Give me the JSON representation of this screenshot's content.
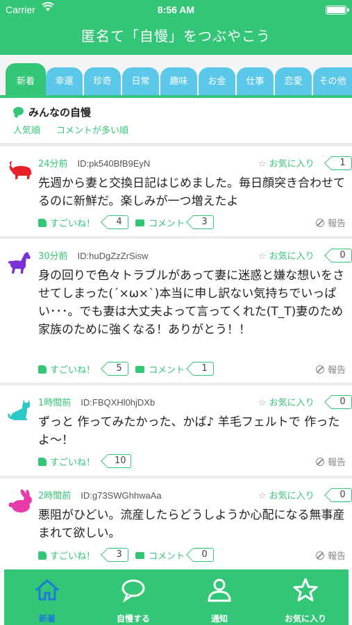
{
  "status_bar": {
    "carrier": "Carrier",
    "time": "8:56 AM"
  },
  "nav": {
    "title": "匿名て「自慢」をつぶやこう"
  },
  "category_tabs": [
    {
      "label": "新着",
      "active": true
    },
    {
      "label": "幸運",
      "active": false
    },
    {
      "label": "珍奇",
      "active": false
    },
    {
      "label": "日常",
      "active": false
    },
    {
      "label": "趣味",
      "active": false
    },
    {
      "label": "お金",
      "active": false
    },
    {
      "label": "仕事",
      "active": false
    },
    {
      "label": "恋愛",
      "active": false
    },
    {
      "label": "その他",
      "active": false
    }
  ],
  "section": {
    "title": "みんなの自慢",
    "sort_popular": "人気順",
    "sort_comments": "コメントが多い順"
  },
  "labels": {
    "favorite": "お気に入り",
    "like": "すごいね！",
    "comment": "コメント",
    "report": "報告"
  },
  "posts": [
    {
      "avatar": "bull-icon",
      "avatar_color": "#e8202a",
      "ago": "24分前",
      "user_id": "ID:pk540BfB9EyN",
      "fav_count": "1",
      "text": "先週から妻と交換日記はじめました。毎日顔突き合わせてるのに新鮮だ。楽しみが一つ増えたよ",
      "like_count": "4",
      "comment_count": "3"
    },
    {
      "avatar": "horse-icon",
      "avatar_color": "#7b2fd6",
      "ago": "30分前",
      "user_id": "ID:huDgZzZrSisw",
      "fav_count": "0",
      "text": "身の回りで色々トラブルがあって妻に迷惑と嫌な想いをさせてしまった(´×ω×`)本当に申し訳ない気持ちでいっぱい･･･。でも妻は大丈夫よって言ってくれた(T_T)妻のため家族のために強くなる！ありがとう！！",
      "like_count": "5",
      "comment_count": "1"
    },
    {
      "avatar": "cat-icon",
      "avatar_color": "#2cc7c7",
      "ago": "1時間前",
      "user_id": "ID:FBQXHl0hjDXb",
      "fav_count": "0",
      "text": "ずっと 作ってみたかった、かば♪ 羊毛フェルトで 作ったよ〜！",
      "like_count": "10",
      "comment_count": ""
    },
    {
      "avatar": "rabbit-icon",
      "avatar_color": "#e83aa9",
      "ago": "2時間前",
      "user_id": "ID:g73SWGhhwaAa",
      "fav_count": "0",
      "text": "悪阻がひどい。流産したらどうしようか心配になる無事産まれて欲しい。",
      "like_count": "3",
      "comment_count": "0"
    }
  ],
  "tabbar": [
    {
      "label": "新着",
      "icon": "home-icon",
      "active": true
    },
    {
      "label": "自慢する",
      "icon": "speech-bubble-icon",
      "active": false
    },
    {
      "label": "通知",
      "icon": "person-icon",
      "active": false
    },
    {
      "label": "お気に入り",
      "icon": "star-icon",
      "active": false
    }
  ],
  "colors": {
    "accent": "#34c677",
    "tab_blue": "#5bc8ea",
    "active_tab_label": "#1a7cd8"
  }
}
